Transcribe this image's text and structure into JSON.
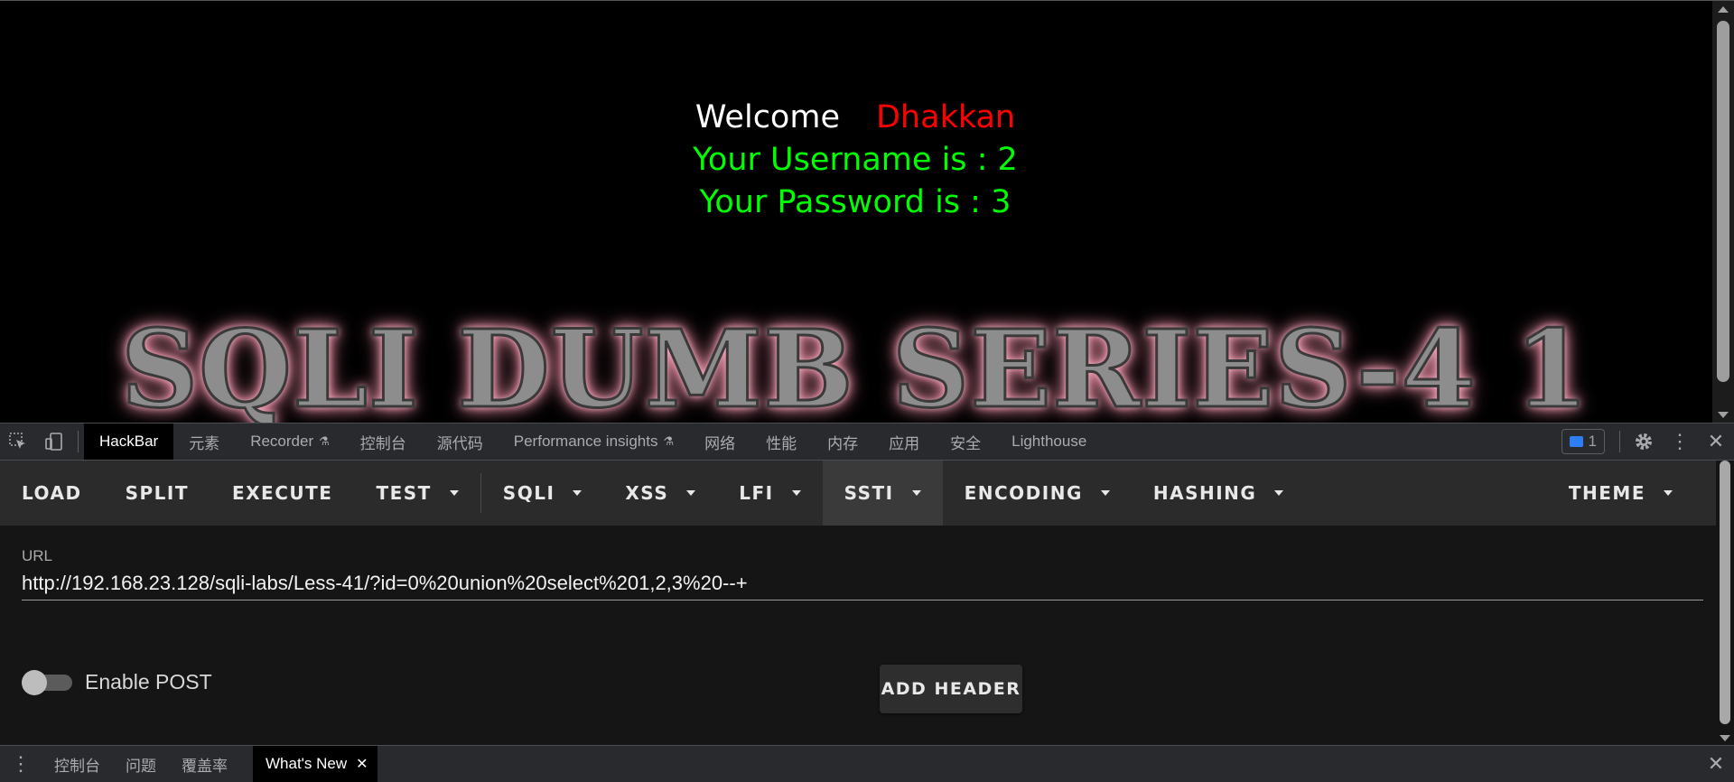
{
  "page": {
    "welcome_label": "Welcome",
    "welcome_name": "Dhakkan",
    "username_line": "Your Username is : 2",
    "password_line": "Your Password is : 3",
    "banner": "SQLI DUMB SERIES-4 1"
  },
  "devtools": {
    "tabs": [
      {
        "label": "HackBar",
        "active": true
      },
      {
        "label": "元素"
      },
      {
        "label": "Recorder",
        "experimental": true
      },
      {
        "label": "控制台"
      },
      {
        "label": "源代码"
      },
      {
        "label": "Performance insights",
        "experimental": true
      },
      {
        "label": "网络"
      },
      {
        "label": "性能"
      },
      {
        "label": "内存"
      },
      {
        "label": "应用"
      },
      {
        "label": "安全"
      },
      {
        "label": "Lighthouse"
      }
    ],
    "issues_count": "1"
  },
  "hackbar": {
    "buttons": {
      "load": "LOAD",
      "split": "SPLIT",
      "execute": "EXECUTE",
      "test": "TEST",
      "sqli": "SQLI",
      "xss": "XSS",
      "lfi": "LFI",
      "ssti": "SSTI",
      "encoding": "ENCODING",
      "hashing": "HASHING",
      "theme": "THEME"
    },
    "url_label": "URL",
    "url_value": "http://192.168.23.128/sqli-labs/Less-41/?id=0%20union%20select%201,2,3%20--+",
    "enable_post_label": "Enable POST",
    "enable_post": false,
    "add_header_label": "ADD HEADER"
  },
  "drawer": {
    "tabs": [
      "控制台",
      "问题",
      "覆盖率"
    ],
    "active_tab": "What's New"
  },
  "colors": {
    "welcome": "#ffffff",
    "name": "#ff0000",
    "credentials": "#00ff00",
    "issues_badge": "#2d7ff9"
  }
}
